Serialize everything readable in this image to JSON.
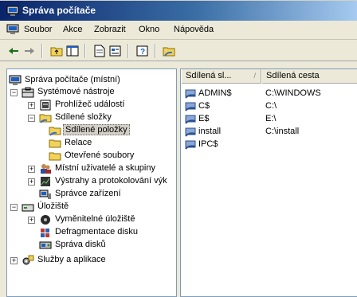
{
  "window": {
    "title": "Správa počítače"
  },
  "menu": [
    "Soubor",
    "Akce",
    "Zobrazit",
    "Okno",
    "Nápověda"
  ],
  "toolbar": {
    "buttons": [
      "back-arrow-icon",
      "forward-arrow-icon",
      "up-folder-icon",
      "show-tree-icon",
      "export-list-icon",
      "properties-icon",
      "help-icon",
      "new-share-icon"
    ]
  },
  "tree": {
    "root": "Správa počítače (místní)",
    "items": [
      "Systémové nástroje",
      "Prohlížeč událostí",
      "Sdílené složky",
      "Sdílené položky",
      "Relace",
      "Otevřené soubory",
      "Místní uživatelé a skupiny",
      "Výstrahy a protokolování výk",
      "Správce zařízení",
      "Úložiště",
      "Vyměnitelné úložiště",
      "Defragmentace disku",
      "Správa disků",
      "Služby a aplikace"
    ]
  },
  "list": {
    "columns": [
      "Sdílená sl...",
      "Sdílená cesta"
    ],
    "rows": [
      {
        "name": "ADMIN$",
        "path": "C:\\WINDOWS"
      },
      {
        "name": "C$",
        "path": "C:\\"
      },
      {
        "name": "E$",
        "path": "E:\\"
      },
      {
        "name": "install",
        "path": "C:\\install"
      },
      {
        "name": "IPC$",
        "path": ""
      }
    ]
  },
  "colors": {
    "title_start": "#0a246a",
    "title_end": "#a6caf0",
    "chrome": "#ece9d8"
  }
}
